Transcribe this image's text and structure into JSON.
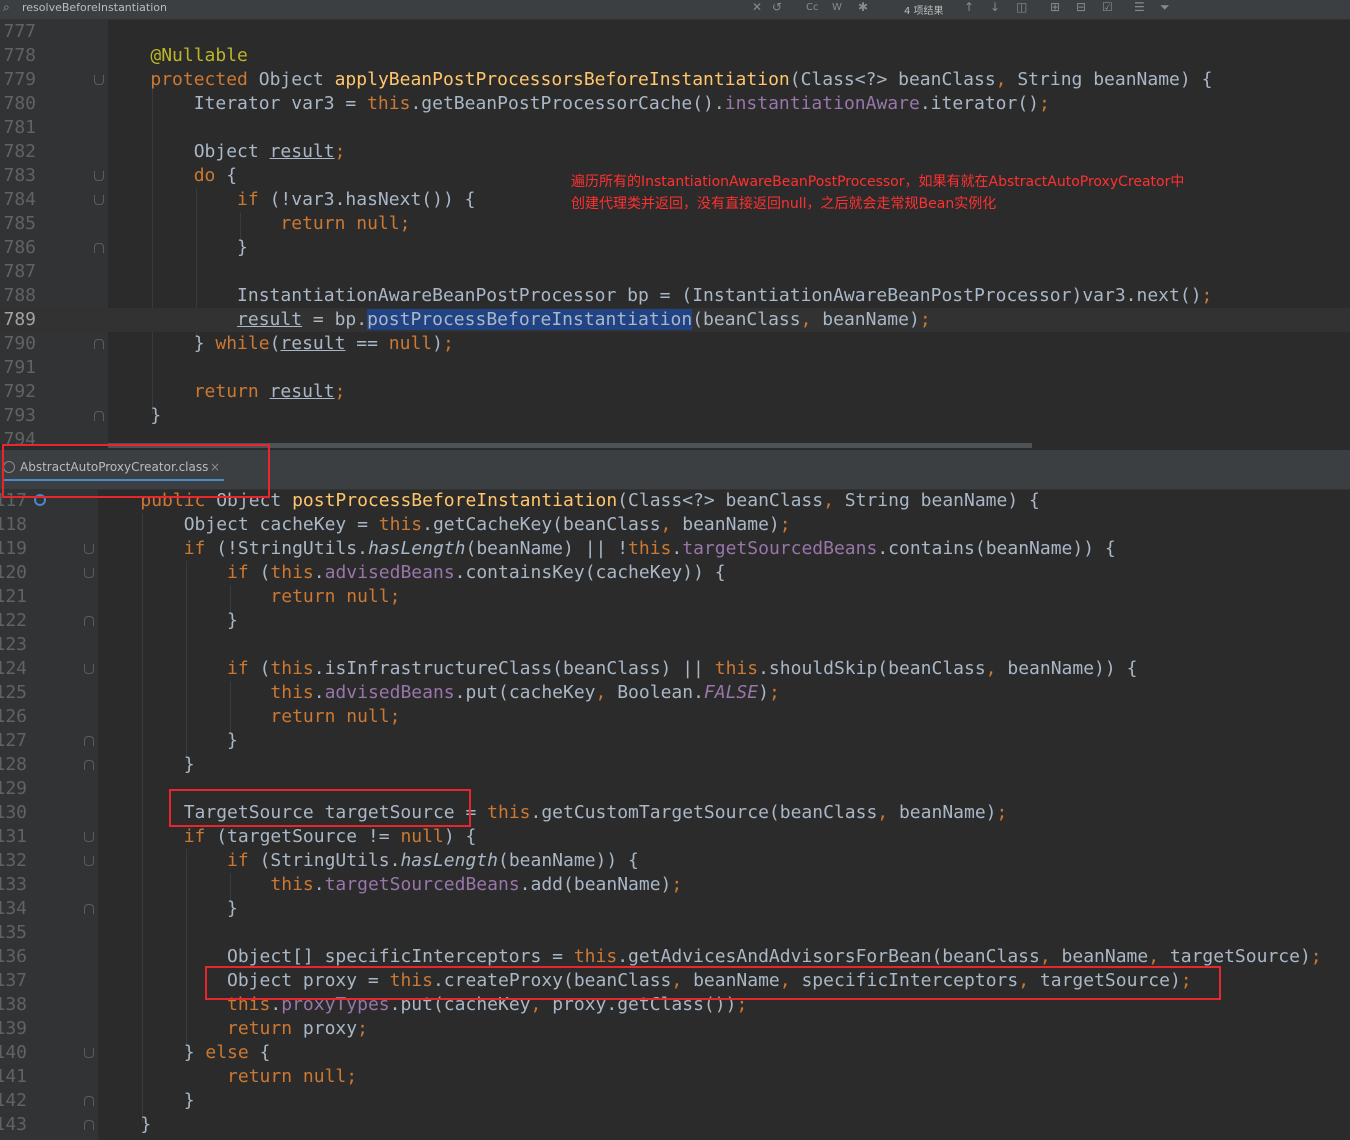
{
  "search": {
    "query": "resolveBeforeInstantiation",
    "match_count": "4 项结果",
    "icons": [
      "search-icon",
      "clear-icon",
      "history-icon",
      "match-case-icon",
      "whole-words-icon",
      "regex-icon",
      "prev-occurrence-icon",
      "next-occurrence-icon",
      "select-all-icon",
      "add-selection-icon",
      "remove-selection-icon",
      "select-all-occurrences-icon",
      "filter-icon"
    ]
  },
  "tab": {
    "label": "AbstractAutoProxyCreator.class",
    "close_glyph": "×"
  },
  "annotation": {
    "line1": "遍历所有的InstantiationAwareBeanPostProcessor，如果有就在AbstractAutoProxyCreator中",
    "line2": "创建代理类并返回，没有直接返回null，之后就会走常规Bean实例化"
  },
  "colors": {
    "annotation": "#ff3030",
    "highlight_box": "#e8262d",
    "keyword": "#cc7832",
    "method": "#ffc66d",
    "field": "#9876aa",
    "annotation_tag": "#bbb529"
  },
  "pane1": {
    "lines": [
      {
        "n": "777",
        "t": []
      },
      {
        "n": "778",
        "t": [
          [
            "    ",
            ""
          ],
          [
            "@Nullable",
            "a"
          ]
        ]
      },
      {
        "n": "779",
        "t": [
          [
            "    ",
            ""
          ],
          [
            "protected ",
            "k"
          ],
          [
            "Object ",
            ""
          ],
          [
            "applyBeanPostProcessorsBeforeInstantiation",
            "f"
          ],
          [
            "(Class<?> beanClass",
            ""
          ],
          [
            ", ",
            "k"
          ],
          [
            "String beanName) {",
            ""
          ]
        ]
      },
      {
        "n": "780",
        "t": [
          [
            "        Iterator var3 = ",
            ""
          ],
          [
            "this",
            "k"
          ],
          [
            ".getBeanPostProcessorCache().",
            ""
          ],
          [
            "instantiationAware",
            "p"
          ],
          [
            ".iterator()",
            ""
          ],
          [
            ";",
            "k"
          ]
        ]
      },
      {
        "n": "781",
        "t": []
      },
      {
        "n": "782",
        "t": [
          [
            "        Object ",
            ""
          ],
          [
            "result",
            "u"
          ],
          [
            ";",
            "k"
          ]
        ]
      },
      {
        "n": "783",
        "t": [
          [
            "        ",
            ""
          ],
          [
            "do ",
            "k"
          ],
          [
            "{",
            ""
          ]
        ]
      },
      {
        "n": "784",
        "t": [
          [
            "            ",
            ""
          ],
          [
            "if ",
            "k"
          ],
          [
            "(!var3.hasNext()) {",
            ""
          ]
        ]
      },
      {
        "n": "785",
        "t": [
          [
            "                ",
            ""
          ],
          [
            "return null;",
            "k"
          ]
        ]
      },
      {
        "n": "786",
        "t": [
          [
            "            }",
            ""
          ]
        ]
      },
      {
        "n": "787",
        "t": []
      },
      {
        "n": "788",
        "t": [
          [
            "            InstantiationAwareBeanPostProcessor bp = (InstantiationAwareBeanPostProcessor)var3.next()",
            ""
          ],
          [
            ";",
            "k"
          ]
        ]
      },
      {
        "n": "789",
        "t": [
          [
            "            ",
            ""
          ],
          [
            "result",
            "u"
          ],
          [
            " = bp.",
            ""
          ],
          [
            "postProcessBeforeInstantiation",
            "hl"
          ],
          [
            "(beanClass",
            ""
          ],
          [
            ", ",
            "k"
          ],
          [
            "beanName)",
            ""
          ],
          [
            ";",
            "k"
          ]
        ]
      },
      {
        "n": "790",
        "t": [
          [
            "        } ",
            ""
          ],
          [
            "while",
            "k"
          ],
          [
            "(",
            ""
          ],
          [
            "result",
            "u"
          ],
          [
            " == ",
            ""
          ],
          [
            "null",
            "k"
          ],
          [
            ")",
            ""
          ],
          [
            ";",
            "k"
          ]
        ]
      },
      {
        "n": "791",
        "t": []
      },
      {
        "n": "792",
        "t": [
          [
            "        ",
            ""
          ],
          [
            "return ",
            "k"
          ],
          [
            "result",
            "u"
          ],
          [
            ";",
            "k"
          ]
        ]
      },
      {
        "n": "793",
        "t": [
          [
            "    }",
            ""
          ]
        ]
      },
      {
        "n": "794",
        "t": []
      }
    ]
  },
  "pane2": {
    "lines": [
      {
        "n": "117",
        "t": [
          [
            "    ",
            ""
          ],
          [
            "public ",
            "k"
          ],
          [
            "Object ",
            ""
          ],
          [
            "postProcessBeforeInstantiation",
            "f"
          ],
          [
            "(Class<?> beanClass",
            ""
          ],
          [
            ", ",
            "k"
          ],
          [
            "String beanName) {",
            ""
          ]
        ]
      },
      {
        "n": "118",
        "t": [
          [
            "        Object cacheKey = ",
            ""
          ],
          [
            "this",
            "k"
          ],
          [
            ".getCacheKey(beanClass",
            ""
          ],
          [
            ", ",
            "k"
          ],
          [
            "beanName)",
            ""
          ],
          [
            ";",
            "k"
          ]
        ]
      },
      {
        "n": "119",
        "t": [
          [
            "        ",
            ""
          ],
          [
            "if ",
            "k"
          ],
          [
            "(!StringUtils.",
            ""
          ],
          [
            "hasLength",
            "i"
          ],
          [
            "(beanName) || !",
            ""
          ],
          [
            "this",
            "k"
          ],
          [
            ".",
            ""
          ],
          [
            "targetSourcedBeans",
            "p"
          ],
          [
            ".contains(beanName)) {",
            ""
          ]
        ]
      },
      {
        "n": "120",
        "t": [
          [
            "            ",
            ""
          ],
          [
            "if ",
            "k"
          ],
          [
            "(",
            ""
          ],
          [
            "this",
            "k"
          ],
          [
            ".",
            ""
          ],
          [
            "advisedBeans",
            "p"
          ],
          [
            ".containsKey(cacheKey)) {",
            ""
          ]
        ]
      },
      {
        "n": "121",
        "t": [
          [
            "                ",
            ""
          ],
          [
            "return null;",
            "k"
          ]
        ]
      },
      {
        "n": "122",
        "t": [
          [
            "            }",
            ""
          ]
        ]
      },
      {
        "n": "123",
        "t": []
      },
      {
        "n": "124",
        "t": [
          [
            "            ",
            ""
          ],
          [
            "if ",
            "k"
          ],
          [
            "(",
            ""
          ],
          [
            "this",
            "k"
          ],
          [
            ".isInfrastructureClass(beanClass) || ",
            ""
          ],
          [
            "this",
            "k"
          ],
          [
            ".shouldSkip(beanClass",
            ""
          ],
          [
            ", ",
            "k"
          ],
          [
            "beanName)) {",
            ""
          ]
        ]
      },
      {
        "n": "125",
        "t": [
          [
            "                ",
            ""
          ],
          [
            "this",
            "k"
          ],
          [
            ".",
            ""
          ],
          [
            "advisedBeans",
            "p"
          ],
          [
            ".put(cacheKey",
            ""
          ],
          [
            ", ",
            "k"
          ],
          [
            "Boolean.",
            ""
          ],
          [
            "FALSE",
            "pi"
          ],
          [
            ")",
            ""
          ],
          [
            ";",
            "k"
          ]
        ]
      },
      {
        "n": "126",
        "t": [
          [
            "                ",
            ""
          ],
          [
            "return null;",
            "k"
          ]
        ]
      },
      {
        "n": "127",
        "t": [
          [
            "            }",
            ""
          ]
        ]
      },
      {
        "n": "128",
        "t": [
          [
            "        }",
            ""
          ]
        ]
      },
      {
        "n": "129",
        "t": []
      },
      {
        "n": "130",
        "t": [
          [
            "        TargetSource targetSource = ",
            ""
          ],
          [
            "this",
            "k"
          ],
          [
            ".getCustomTargetSource(beanClass",
            ""
          ],
          [
            ", ",
            "k"
          ],
          [
            "beanName)",
            ""
          ],
          [
            ";",
            "k"
          ]
        ]
      },
      {
        "n": "131",
        "t": [
          [
            "        ",
            ""
          ],
          [
            "if ",
            "k"
          ],
          [
            "(targetSource != ",
            ""
          ],
          [
            "null",
            "k"
          ],
          [
            ") {",
            ""
          ]
        ]
      },
      {
        "n": "132",
        "t": [
          [
            "            ",
            ""
          ],
          [
            "if ",
            "k"
          ],
          [
            "(StringUtils.",
            ""
          ],
          [
            "hasLength",
            "i"
          ],
          [
            "(beanName)) {",
            ""
          ]
        ]
      },
      {
        "n": "133",
        "t": [
          [
            "                ",
            ""
          ],
          [
            "this",
            "k"
          ],
          [
            ".",
            ""
          ],
          [
            "targetSourcedBeans",
            "p"
          ],
          [
            ".add(beanName)",
            ""
          ],
          [
            ";",
            "k"
          ]
        ]
      },
      {
        "n": "134",
        "t": [
          [
            "            }",
            ""
          ]
        ]
      },
      {
        "n": "135",
        "t": []
      },
      {
        "n": "136",
        "t": [
          [
            "            Object[] specificInterceptors = ",
            ""
          ],
          [
            "this",
            "k"
          ],
          [
            ".getAdvicesAndAdvisorsForBean(beanClass",
            ""
          ],
          [
            ", ",
            "k"
          ],
          [
            "beanName",
            ""
          ],
          [
            ", ",
            "k"
          ],
          [
            "targetSource)",
            ""
          ],
          [
            ";",
            "k"
          ]
        ]
      },
      {
        "n": "137",
        "t": [
          [
            "            Object proxy = ",
            ""
          ],
          [
            "this",
            "k"
          ],
          [
            ".createProxy(beanClass",
            ""
          ],
          [
            ", ",
            "k"
          ],
          [
            "beanName",
            ""
          ],
          [
            ", ",
            "k"
          ],
          [
            "specificInterceptors",
            ""
          ],
          [
            ", ",
            "k"
          ],
          [
            "targetSource)",
            ""
          ],
          [
            ";",
            "k"
          ]
        ]
      },
      {
        "n": "138",
        "t": [
          [
            "            ",
            ""
          ],
          [
            "this",
            "k"
          ],
          [
            ".",
            ""
          ],
          [
            "proxyTypes",
            "p"
          ],
          [
            ".put(cacheKey",
            ""
          ],
          [
            ", ",
            "k"
          ],
          [
            "proxy.getClass())",
            ""
          ],
          [
            ";",
            "k"
          ]
        ]
      },
      {
        "n": "139",
        "t": [
          [
            "            ",
            ""
          ],
          [
            "return ",
            "k"
          ],
          [
            "proxy",
            ""
          ],
          [
            ";",
            "k"
          ]
        ]
      },
      {
        "n": "140",
        "t": [
          [
            "        } ",
            ""
          ],
          [
            "else ",
            "k"
          ],
          [
            "{",
            ""
          ]
        ]
      },
      {
        "n": "141",
        "t": [
          [
            "            ",
            ""
          ],
          [
            "return null;",
            "k"
          ]
        ]
      },
      {
        "n": "142",
        "t": [
          [
            "        }",
            ""
          ]
        ]
      },
      {
        "n": "143",
        "t": [
          [
            "    }",
            ""
          ]
        ]
      }
    ]
  }
}
